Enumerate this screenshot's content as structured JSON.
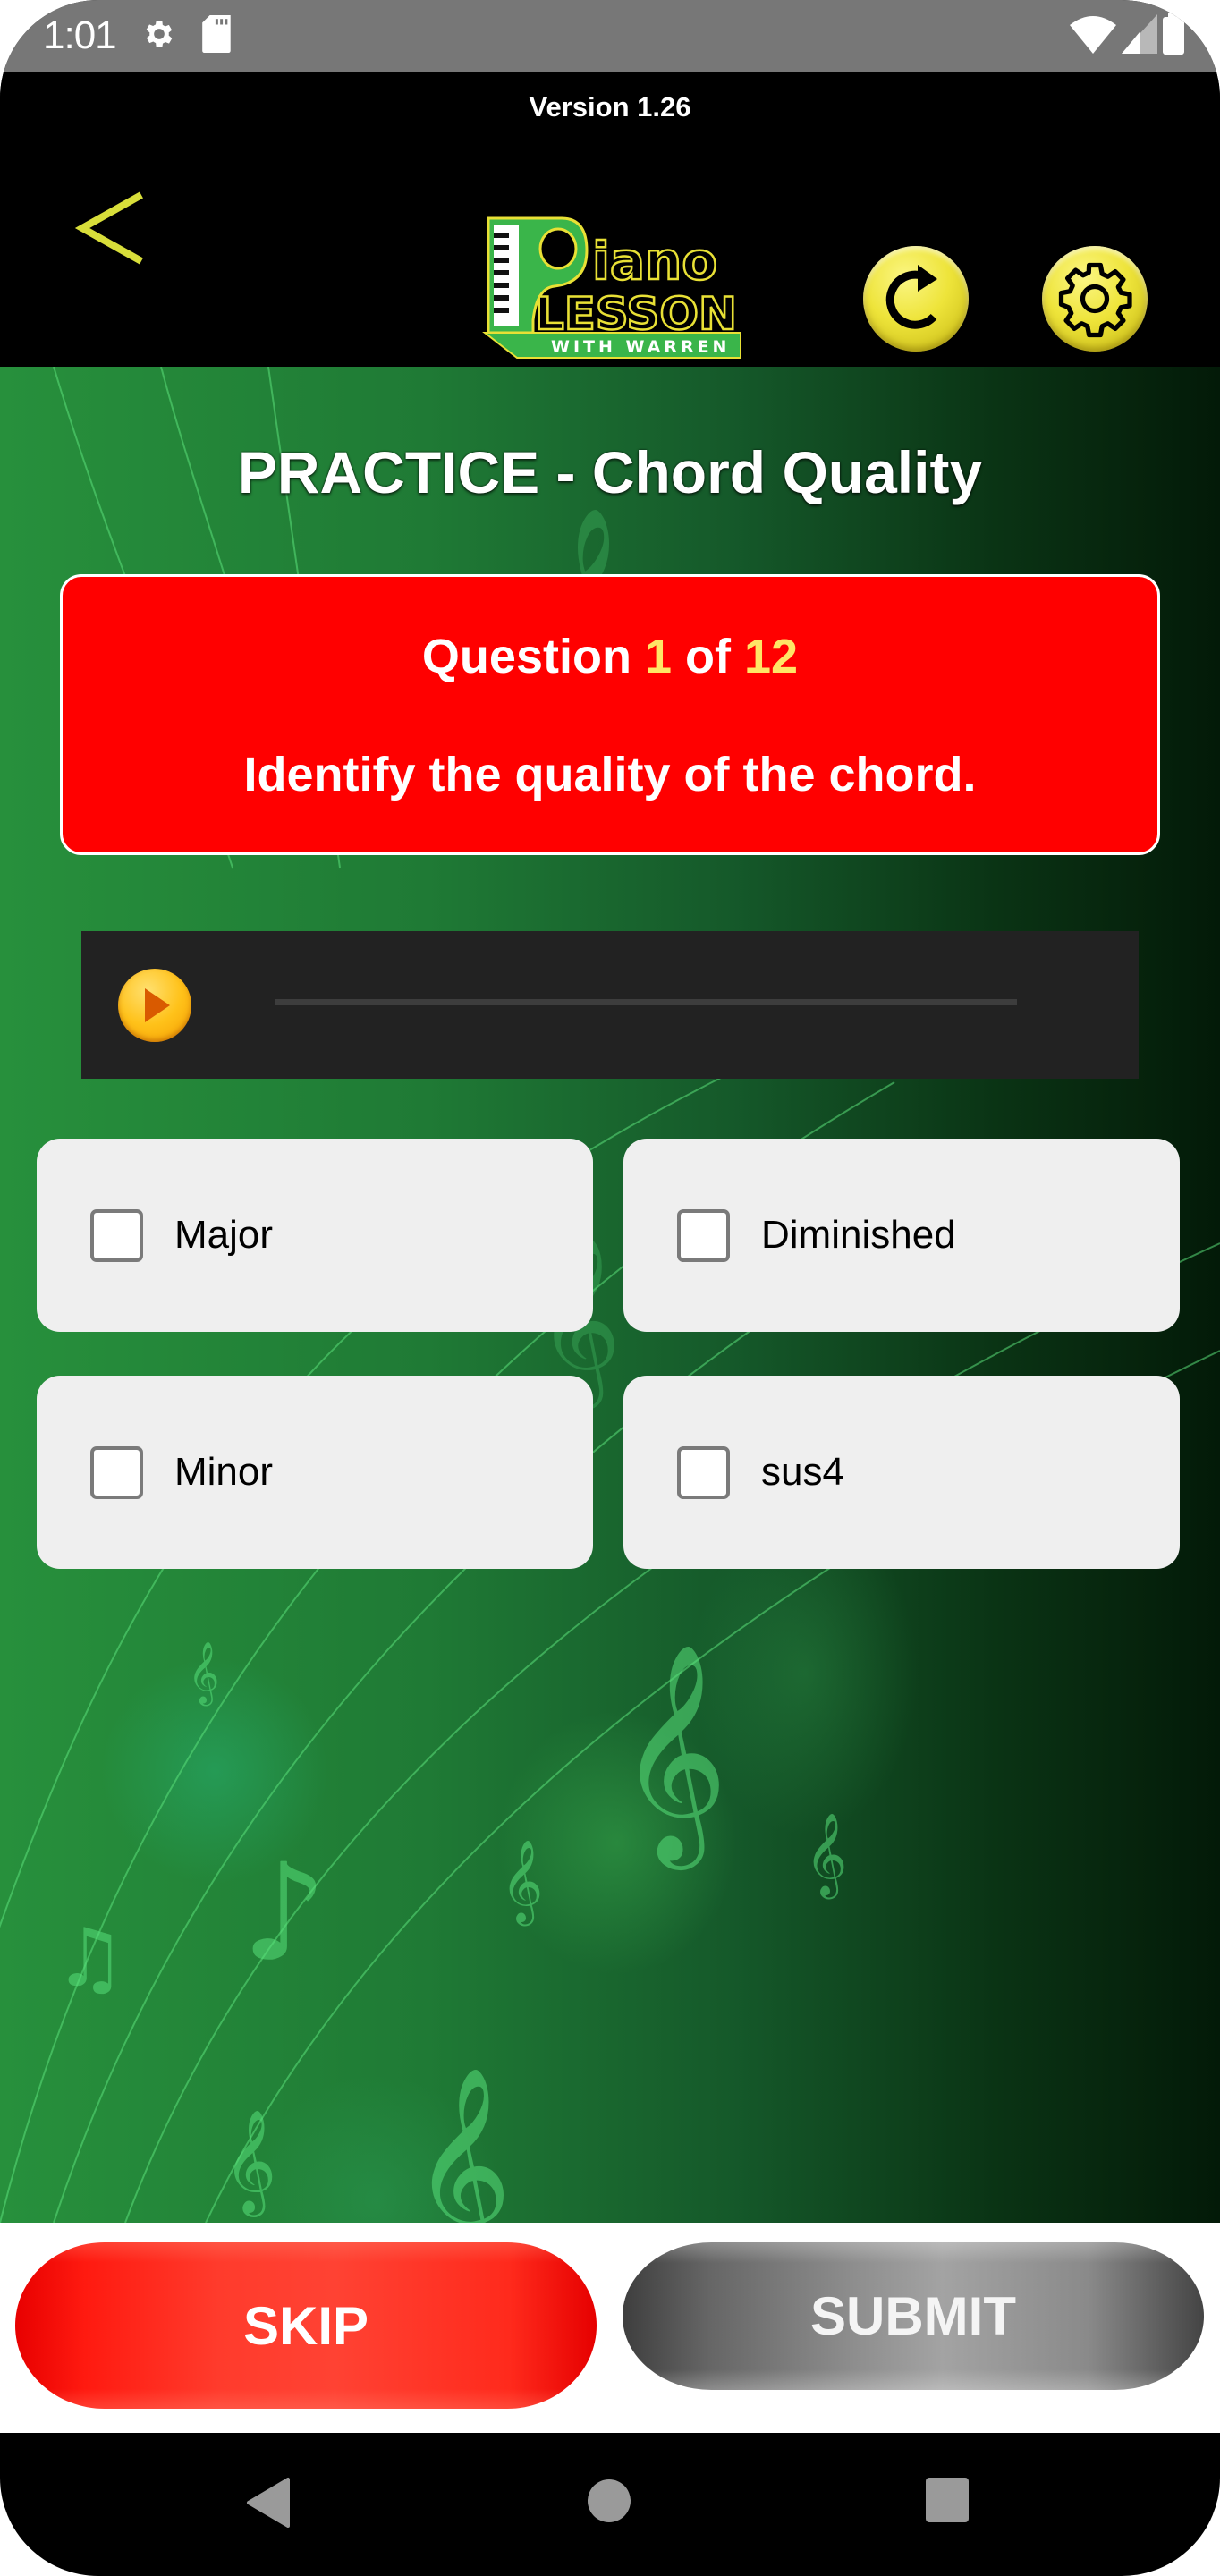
{
  "status_bar": {
    "time": "1:01",
    "left_icons": [
      "settings-icon",
      "sd-card-icon"
    ],
    "right_icons": [
      "wifi-icon",
      "signal-icon",
      "battery-icon"
    ]
  },
  "header": {
    "version": "Version 1.26",
    "logo": {
      "line1": "Piano",
      "line2": "LESSON",
      "line3": "WITH WARREN"
    },
    "back_icon": "chevron-left-icon",
    "refresh_icon": "refresh-icon",
    "settings_icon": "gear-icon"
  },
  "main": {
    "title": "PRACTICE - Chord Quality",
    "question": {
      "label": "Question",
      "current": "1",
      "of_label": "of",
      "total": "12",
      "prompt": "Identify the quality of the chord."
    },
    "audio": {
      "play_icon": "play-icon",
      "progress": 0
    },
    "options": [
      {
        "label": "Major",
        "checked": false
      },
      {
        "label": "Diminished",
        "checked": false
      },
      {
        "label": "Minor",
        "checked": false
      },
      {
        "label": "sus4",
        "checked": false
      }
    ]
  },
  "actions": {
    "skip_label": "SKIP",
    "submit_label": "SUBMIT"
  },
  "nav_bar": {
    "items": [
      "back-icon",
      "home-icon",
      "recents-icon"
    ]
  },
  "colors": {
    "accent_yellow": "#e8e035",
    "question_card": "#ff0000",
    "question_number": "#ffe566",
    "skip_red": "#ff3b2c",
    "submit_gray": "#8e8e8e",
    "logo_green": "#3ab54a"
  }
}
